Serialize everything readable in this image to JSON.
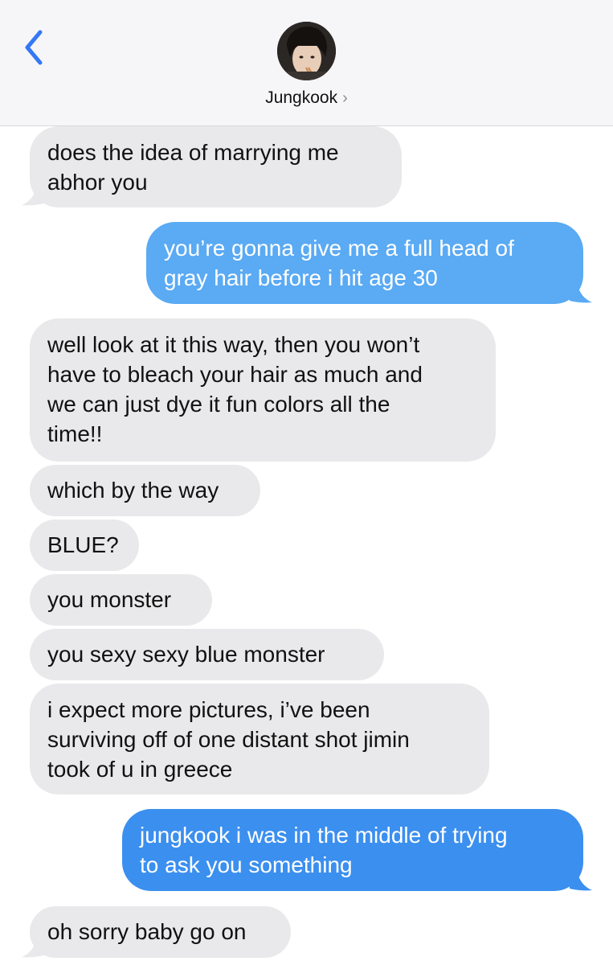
{
  "header": {
    "contact_name": "Jungkook",
    "chevron": "›",
    "back_icon": "chevron-left-icon",
    "accent_color": "#3478f6"
  },
  "messages": [
    {
      "from": "them",
      "text": "does the idea of marrying me\nabhor you"
    },
    {
      "from": "me",
      "text": "you’re gonna give me a full head of\ngray hair before i hit age 30"
    },
    {
      "from": "them",
      "text": "well look at it this way, then you won’t\nhave to bleach your hair as much and\nwe can just dye it fun colors all the\ntime!!"
    },
    {
      "from": "them",
      "text": "which by the way"
    },
    {
      "from": "them",
      "text": "BLUE?"
    },
    {
      "from": "them",
      "text": "you monster"
    },
    {
      "from": "them",
      "text": "you sexy sexy blue monster"
    },
    {
      "from": "them",
      "text": "i expect more pictures, i’ve been\nsurviving off of one distant shot jimin\ntook of u in greece"
    },
    {
      "from": "me",
      "text": "jungkook i was in the middle of trying\nto ask you something"
    },
    {
      "from": "them",
      "text": "oh sorry baby go on"
    }
  ],
  "colors": {
    "received_bubble": "#e9e9eb",
    "sent_bubble": "#3b8fef",
    "header_bg": "#f6f6f8"
  }
}
